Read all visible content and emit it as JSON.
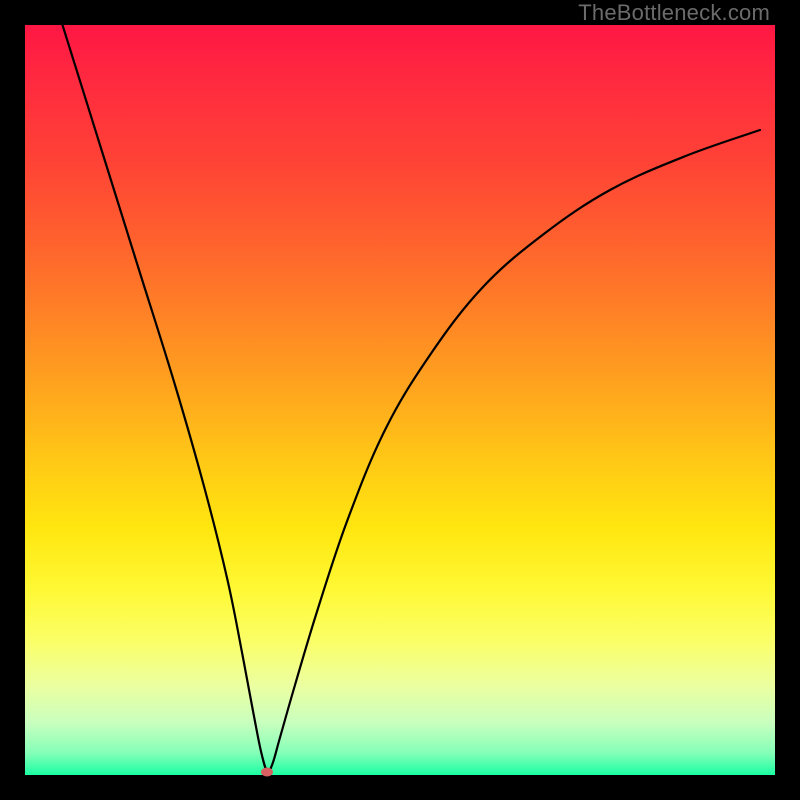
{
  "watermark": "TheBottleneck.com",
  "chart_data": {
    "type": "line",
    "title": "",
    "xlabel": "",
    "ylabel": "",
    "xlim": [
      0,
      100
    ],
    "ylim": [
      0,
      100
    ],
    "x_axis_visible": false,
    "y_axis_visible": false,
    "grid": false,
    "legend": false,
    "background_gradient": {
      "top_color": "#ff1744",
      "middle_color": "#ffe60f",
      "bottom_color": "#1bffa3",
      "meaning_top": "high bottleneck",
      "meaning_bottom": "no bottleneck"
    },
    "series": [
      {
        "name": "bottleneck-curve",
        "color": "#000000",
        "x": [
          5,
          10,
          15,
          20,
          24,
          27,
          29,
          30.5,
          31.5,
          32.3,
          33,
          34,
          36,
          39,
          43,
          48,
          54,
          61,
          69,
          78,
          88,
          98
        ],
        "values": [
          100,
          84,
          68,
          52,
          38,
          26,
          16,
          8,
          3,
          0.5,
          1.5,
          5,
          12,
          22,
          34,
          46,
          56,
          65,
          72,
          78,
          82.5,
          86
        ]
      }
    ],
    "markers": [
      {
        "name": "optimal-point",
        "x": 32.2,
        "y": 0.4,
        "color": "#d86060"
      }
    ]
  }
}
